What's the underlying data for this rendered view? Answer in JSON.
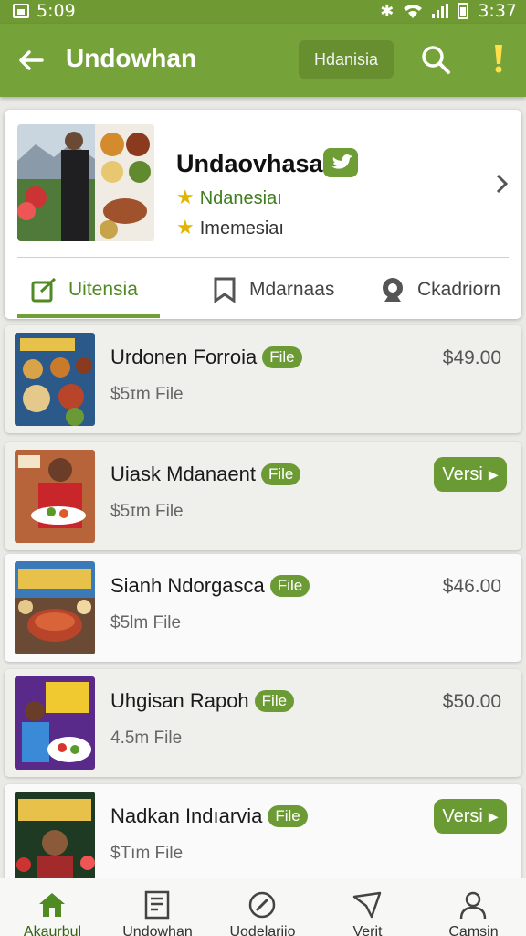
{
  "status": {
    "time_left": "5:09",
    "time_right": "3:37"
  },
  "appbar": {
    "title": "Undowhan",
    "chip_label": "Hdanisia"
  },
  "profile": {
    "name": "Undaovhasa",
    "rating_1": "Ndanesiaı",
    "rating_2": "Imemesiaı",
    "tabs": [
      "Uitensia",
      "Mdarnaas",
      "Ckadriorn"
    ],
    "active_tab": 0
  },
  "items": [
    {
      "title": "Urdonen Forroia",
      "badge": "File",
      "subtitle": "$5ɪm File",
      "price": "$49.00",
      "action": "",
      "style": "shaded"
    },
    {
      "title": "Uiask Mdanaent",
      "badge": "File",
      "subtitle": "$5ɪm File",
      "price": "",
      "action": "Versi",
      "style": "shaded"
    },
    {
      "title": "Sianh Ndorgasca",
      "badge": "File",
      "subtitle": "$5lm File",
      "price": "$46.00",
      "action": "",
      "style": "light"
    },
    {
      "title": "Uhgisan Rapoh",
      "badge": "File",
      "subtitle": "4.5m File",
      "price": "$50.00",
      "action": "",
      "style": "shaded"
    },
    {
      "title": "Nadkan Indıarvia",
      "badge": "File",
      "subtitle": "$Tım File",
      "price": "",
      "action": "Versi",
      "style": "light"
    }
  ],
  "bottom_nav": [
    {
      "label": "Akaurbul",
      "icon": "home-icon",
      "active": true
    },
    {
      "label": "Undowhan",
      "icon": "document-icon",
      "active": false
    },
    {
      "label": "Uodelarijo",
      "icon": "compass-icon",
      "active": false
    },
    {
      "label": "Verit",
      "icon": "send-icon",
      "active": false
    },
    {
      "label": "Camsin",
      "icon": "person-icon",
      "active": false
    }
  ],
  "colors": {
    "primary": "#76a23a",
    "accent_star": "#e3b400",
    "text_dark": "#1a1a1a"
  }
}
